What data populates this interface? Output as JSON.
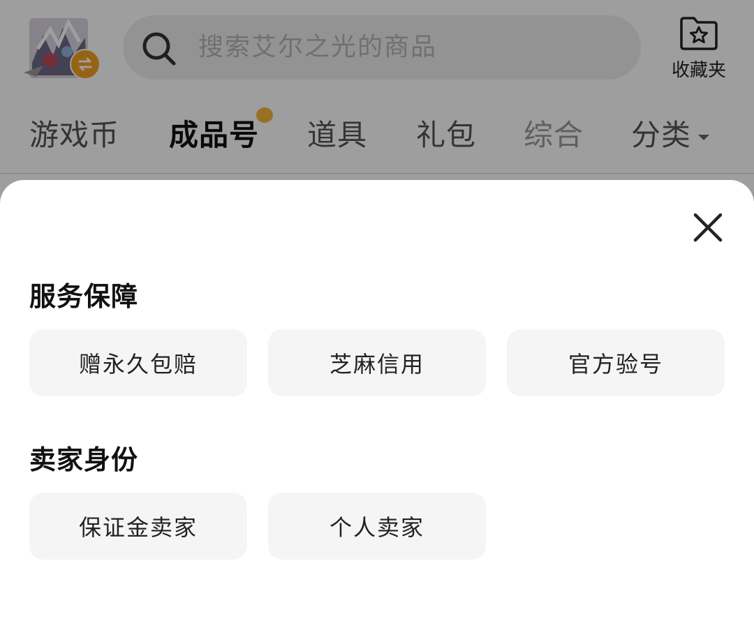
{
  "header": {
    "search": {
      "placeholder": "搜索艾尔之光的商品"
    },
    "favorites_label": "收藏夹",
    "tabs": [
      {
        "label": "游戏币",
        "active": false
      },
      {
        "label": "成品号",
        "active": true
      },
      {
        "label": "道具",
        "active": false
      },
      {
        "label": "礼包",
        "active": false
      },
      {
        "label": "综合",
        "active": false
      },
      {
        "label": "分类",
        "active": false
      }
    ]
  },
  "filter_sheet": {
    "sections": [
      {
        "title": "服务保障",
        "options": [
          "赠永久包赔",
          "芝麻信用",
          "官方验号"
        ]
      },
      {
        "title": "卖家身份",
        "options": [
          "保证金卖家",
          "个人卖家"
        ]
      }
    ]
  },
  "colors": {
    "accent": "#f2a122",
    "overlay": "rgba(0,0,0,0.38)",
    "option_bg": "#f5f5f5"
  },
  "icons": {
    "search": "search-icon",
    "favorites": "star-folder-icon",
    "switch_game": "swap-icon",
    "close": "close-icon"
  }
}
